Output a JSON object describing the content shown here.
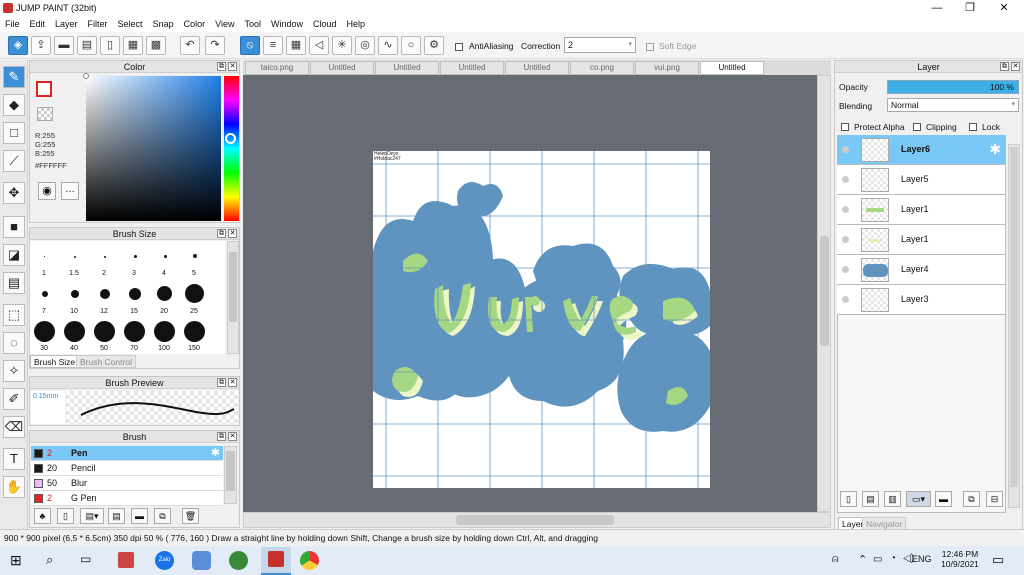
{
  "window": {
    "title": "JUMP PAINT (32bit)",
    "minimize": "—",
    "maximize": "❐",
    "close": "✕"
  },
  "menu": [
    "File",
    "Edit",
    "Layer",
    "Filter",
    "Select",
    "Snap",
    "Color",
    "View",
    "Tool",
    "Window",
    "Cloud",
    "Help"
  ],
  "toolbar": {
    "antialias_label": "AntiAliasing",
    "correction_label": "Correction",
    "correction_value": "2",
    "softedge_label": "Soft Edge"
  },
  "tabs": [
    "taico.png",
    "Untitled",
    "Untitled",
    "Untitled",
    "Untitled",
    "co.png",
    "vui.png",
    "Untitled"
  ],
  "color_panel": {
    "title": "Color",
    "r": "R:255",
    "g": "G:255",
    "b": "B:255",
    "hex": "#FFFFFF",
    "fg": "#ffffff",
    "hue_marker": "#3b8fd6"
  },
  "brush_size_panel": {
    "title": "Brush Size",
    "sizes": [
      "1",
      "1.5",
      "2",
      "3",
      "4",
      "5",
      "7",
      "10",
      "12",
      "15",
      "20",
      "25",
      "30",
      "40",
      "50",
      "70",
      "100",
      "150"
    ],
    "tab_active": "Brush Size",
    "tab_inactive": "Brush Control"
  },
  "brush_preview": {
    "title": "Brush Preview",
    "size_text": "0.15mm"
  },
  "brush_panel": {
    "title": "Brush",
    "items": [
      {
        "size": "2",
        "name": "Pen",
        "color": "#1a1a1a",
        "selected": true
      },
      {
        "size": "20",
        "name": "Pencil",
        "color": "#1a1a1a",
        "selected": false
      },
      {
        "size": "50",
        "name": "Blur",
        "color": "#f2b8f2",
        "selected": false
      },
      {
        "size": "2",
        "name": "G Pen",
        "color": "#e8232a",
        "selected": false
      }
    ]
  },
  "layer_panel": {
    "title": "Layer",
    "opacity_label": "Opacity",
    "opacity_value": "100 %",
    "blending_label": "Blending",
    "blending_value": "Normal",
    "protect_alpha": "Protect Alpha",
    "clipping": "Clipping",
    "lock": "Lock",
    "layers": [
      {
        "name": "Layer6",
        "selected": true
      },
      {
        "name": "Layer5",
        "selected": false
      },
      {
        "name": "Layer1",
        "selected": false
      },
      {
        "name": "Layer1",
        "selected": false
      },
      {
        "name": "Layer4",
        "selected": false
      },
      {
        "name": "Layer3",
        "selected": false
      }
    ],
    "tab_active": "Layer",
    "tab_inactive": "Navigator"
  },
  "canvas": {
    "watermark_line1": "HelenDeys",
    "watermark_line2": "#Holdac247",
    "artwork_text": "Vui vẻ",
    "blob_color": "#5f94c0",
    "text_color": "#a6d883",
    "text_shadow_color": "#ecf5c4"
  },
  "status": {
    "text": "900 * 900 pixel  (6.5 * 6.5cm)  350 dpi  50 %  ( 776, 160 )  Draw a straight line by holding down Shift, Change a brush size by holding down Ctrl, Alt, and dragging"
  },
  "taskbar": {
    "lang": "ENG",
    "time": "12:46 PM",
    "date": "10/9/2021"
  }
}
